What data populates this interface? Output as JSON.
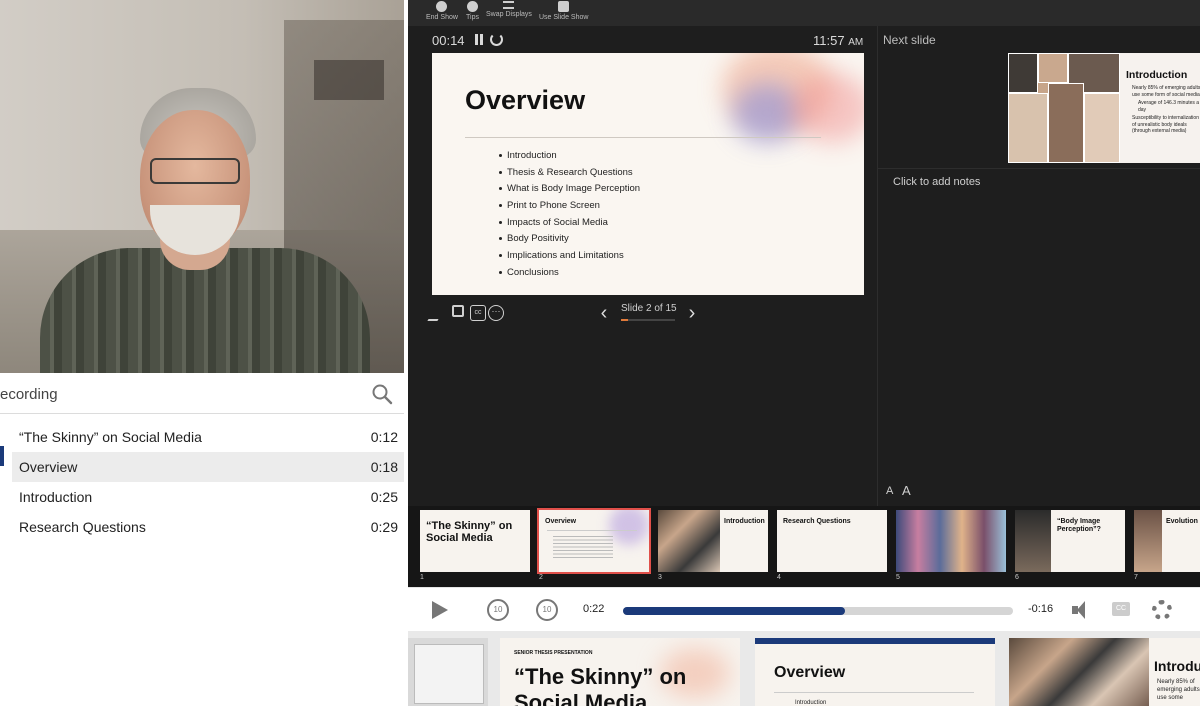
{
  "index": {
    "title": "ecording",
    "items": [
      {
        "label": "“The Skinny” on Social Media",
        "time": "0:12"
      },
      {
        "label": "Overview",
        "time": "0:18"
      },
      {
        "label": "Introduction",
        "time": "0:25"
      },
      {
        "label": "Research Questions",
        "time": "0:29"
      }
    ]
  },
  "presenter": {
    "toolbar": [
      "End Show",
      "Tips",
      "Swap Displays",
      "Use Slide Show"
    ],
    "timer": "00:14",
    "clock": "11:57",
    "clock_ampm": "AM",
    "next_label": "Next slide",
    "notes_placeholder": "Click to add notes",
    "slide_counter": "Slide 2 of 15",
    "slide_progress": 0.133,
    "current_slide": {
      "title": "Overview",
      "bullets": [
        "Introduction",
        "Thesis & Research Questions",
        "What is Body Image Perception",
        "Print to Phone Screen",
        "Impacts of Social Media",
        "Body Positivity",
        "Implications and Limitations",
        "Conclusions"
      ]
    },
    "next_slide": {
      "title": "Introduction",
      "bullets": [
        "Nearly 85% of emerging adults use some form of social media",
        "Average of 146.3 minutes a day",
        "Susceptibility to internalization of unrealistic body ideals (through external media)"
      ]
    },
    "font_buttons": [
      "A",
      "A"
    ],
    "thumbnails": [
      {
        "num": "1",
        "title": "“The Skinny” on Social Media"
      },
      {
        "num": "2",
        "title": "Overview"
      },
      {
        "num": "3",
        "title": "Introduction"
      },
      {
        "num": "4",
        "title": "Research Questions"
      },
      {
        "num": "5",
        "title": ""
      },
      {
        "num": "6",
        "title": "“Body Image Perception”?"
      },
      {
        "num": "7",
        "title": "Evolution"
      }
    ]
  },
  "player": {
    "current_time": "0:22",
    "remaining": "-0:16",
    "progress": 0.57,
    "skip_back": "10",
    "skip_fwd": "10",
    "cc": "CC"
  },
  "filmstrip": {
    "frames": [
      {
        "title": "“The Skinny” on Social Media",
        "kicker": "SENIOR THESIS PRESENTATION"
      },
      {
        "title": "Overview",
        "sub": "Introduction"
      },
      {
        "title": "Introdu",
        "sub": "Nearly 85% of emerging adults use some"
      }
    ]
  },
  "colors": {
    "accent": "#1b3a7a",
    "selected": "#e0504a",
    "progress_orange": "#e07a3a"
  }
}
